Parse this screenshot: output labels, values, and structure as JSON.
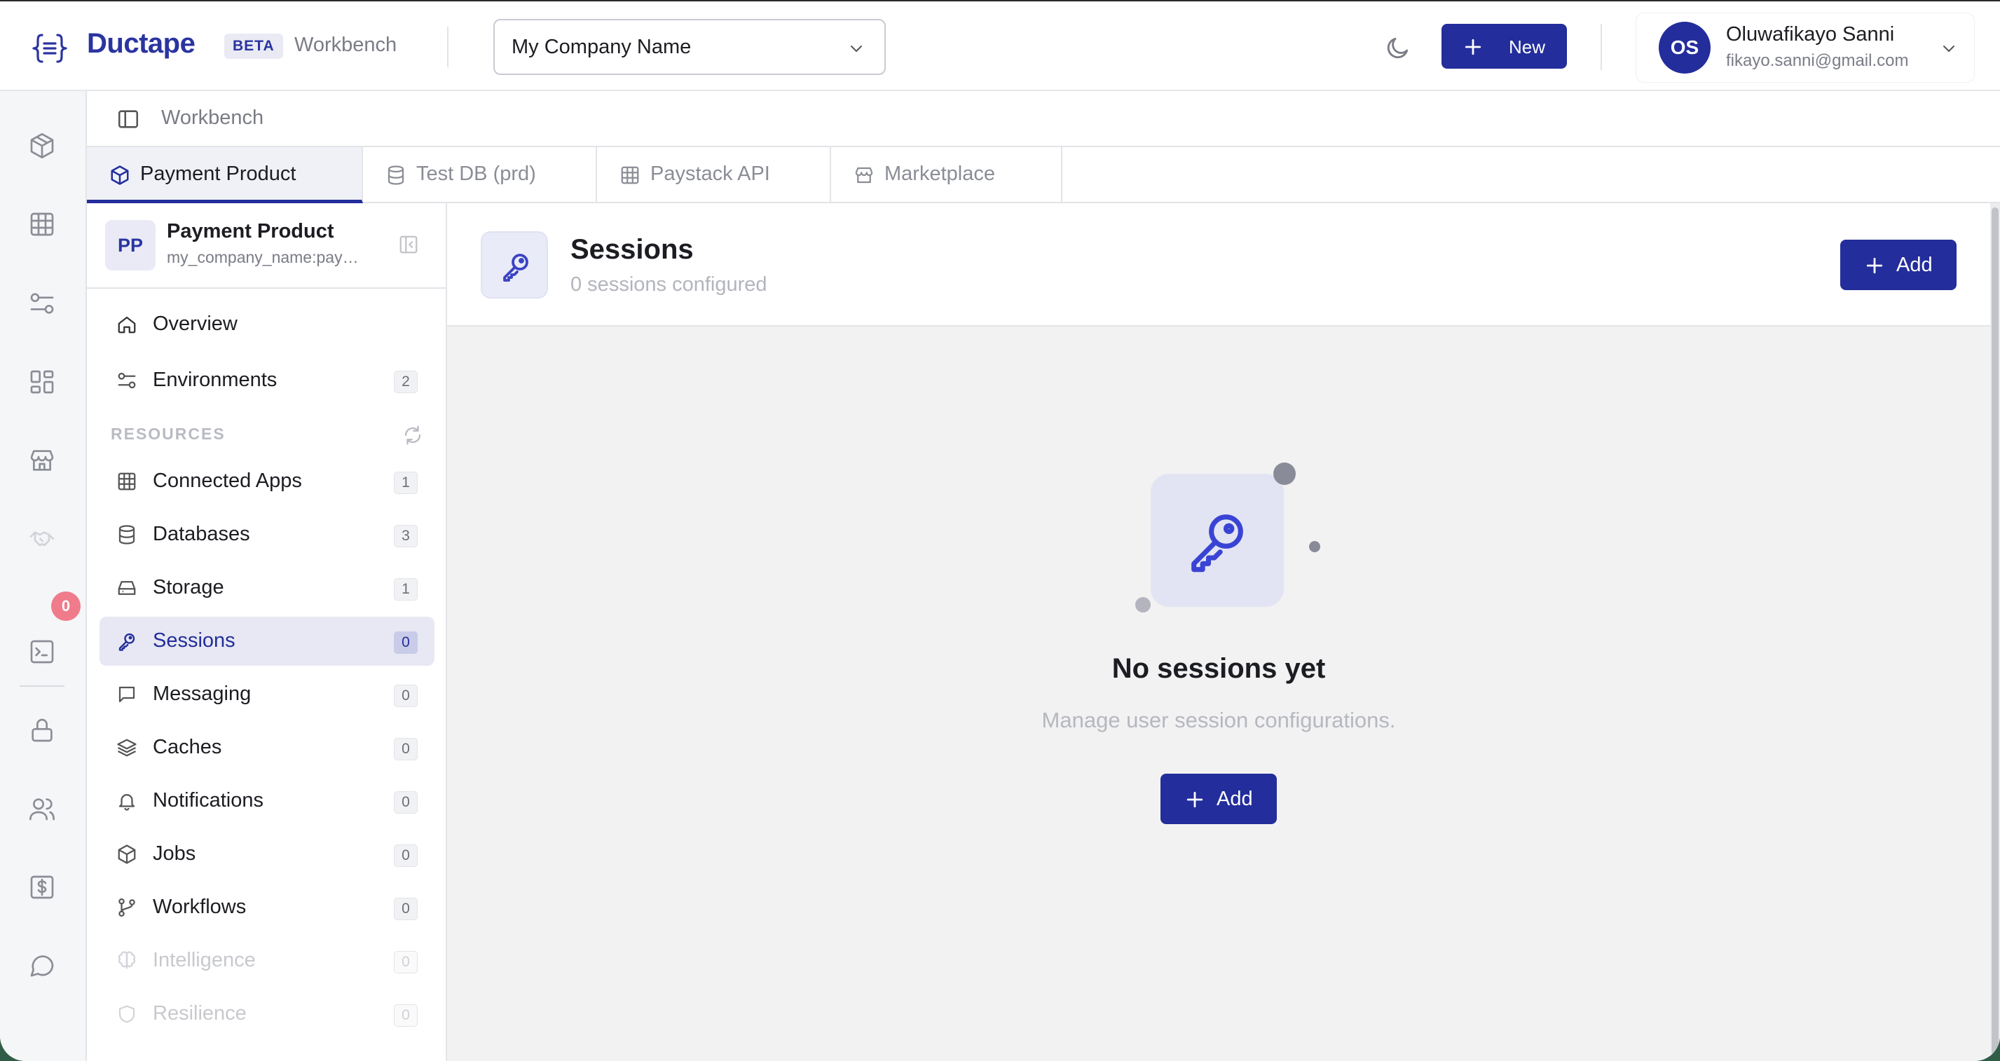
{
  "header": {
    "brand": "Ductape",
    "beta": "BETA",
    "section": "Workbench",
    "company_select": "My Company Name",
    "new_label": "New",
    "user": {
      "initials": "OS",
      "name": "Oluwafikayo Sanni",
      "email": "fikayo.sanni@gmail.com"
    }
  },
  "rail": {
    "icons": [
      "cube-icon",
      "grid-icon",
      "sliders-icon",
      "dashboard-icon",
      "store-icon",
      "handshake-icon",
      "terminal-icon",
      "lock-icon",
      "users-icon",
      "billing-icon",
      "chat-icon"
    ],
    "badge": "0"
  },
  "breadcrumb": {
    "label": "Workbench"
  },
  "tabs": [
    {
      "label": "Payment Product",
      "icon": "cube-icon",
      "active": true
    },
    {
      "label": "Test DB (prd)",
      "icon": "database-icon",
      "active": false
    },
    {
      "label": "Paystack API",
      "icon": "grid-icon",
      "active": false
    },
    {
      "label": "Marketplace",
      "icon": "store-icon",
      "active": false
    }
  ],
  "product": {
    "initials": "PP",
    "title": "Payment Product",
    "subtitle": "my_company_name:payment_product"
  },
  "sidebar": {
    "overview": "Overview",
    "environments": {
      "label": "Environments",
      "count": "2"
    },
    "resources_label": "RESOURCES",
    "items": [
      {
        "label": "Connected Apps",
        "count": "1",
        "icon": "grid-icon"
      },
      {
        "label": "Databases",
        "count": "3",
        "icon": "database-icon"
      },
      {
        "label": "Storage",
        "count": "1",
        "icon": "storage-icon"
      },
      {
        "label": "Sessions",
        "count": "0",
        "icon": "key-icon",
        "active": true
      },
      {
        "label": "Messaging",
        "count": "0",
        "icon": "message-icon"
      },
      {
        "label": "Caches",
        "count": "0",
        "icon": "layers-icon"
      },
      {
        "label": "Notifications",
        "count": "0",
        "icon": "bell-icon"
      },
      {
        "label": "Jobs",
        "count": "0",
        "icon": "cube-icon"
      },
      {
        "label": "Workflows",
        "count": "0",
        "icon": "git-branch-icon"
      },
      {
        "label": "Intelligence",
        "count": "0",
        "icon": "brain-icon",
        "disabled": true
      },
      {
        "label": "Resilience",
        "count": "0",
        "icon": "shield-icon",
        "disabled": true
      }
    ]
  },
  "main": {
    "title": "Sessions",
    "subtitle": "0 sessions configured",
    "add_label": "Add",
    "empty_title": "No sessions yet",
    "empty_subtitle": "Manage user session configurations.",
    "empty_add_label": "Add"
  },
  "colors": {
    "accent": "#232d9b",
    "brand": "#2a34a0",
    "active_bg": "#e7e8f3",
    "badge": "#ef7b8b"
  }
}
